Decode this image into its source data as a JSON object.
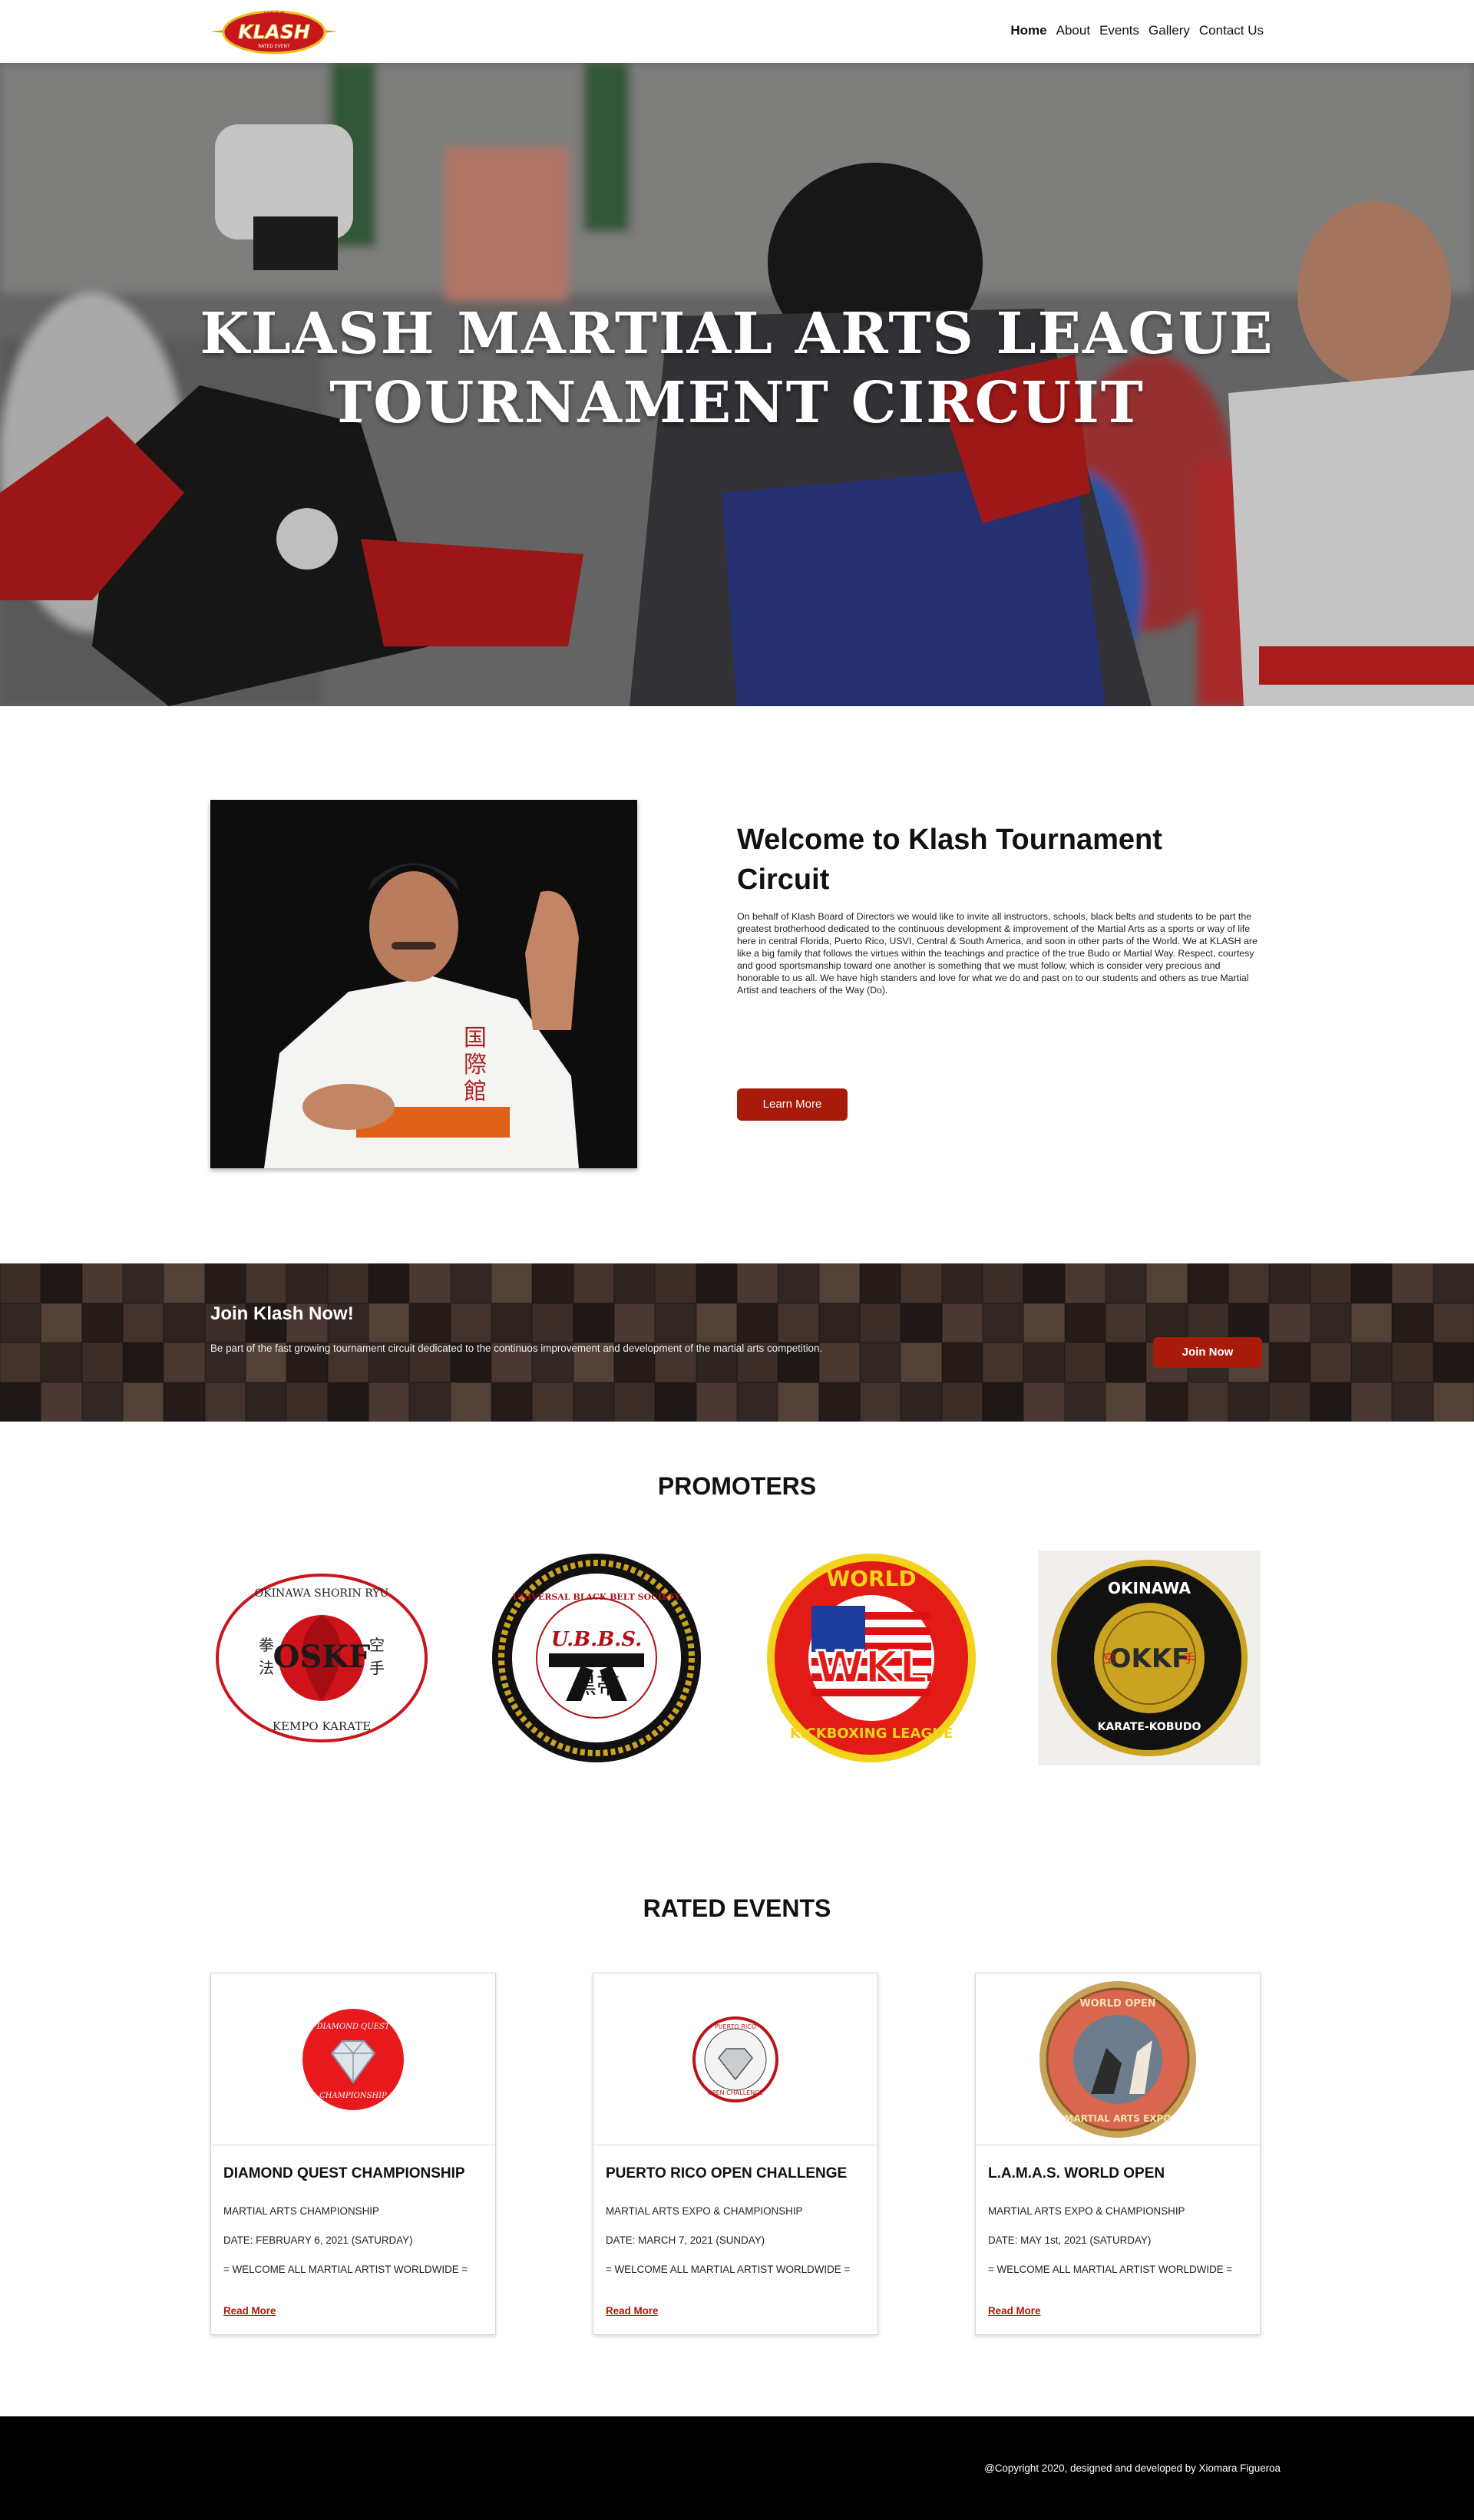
{
  "nav": {
    "logo": {
      "top_text": "UBBS",
      "main_text": "KLASH",
      "bottom_text": "RATED EVENT"
    },
    "items": [
      {
        "label": "Home",
        "active": true
      },
      {
        "label": "About"
      },
      {
        "label": "Events"
      },
      {
        "label": "Gallery"
      },
      {
        "label": "Contact Us"
      }
    ]
  },
  "hero": {
    "title_line1": "KLASH MARTIAL ARTS LEAGUE",
    "title_line2": "TOURNAMENT CIRCUIT"
  },
  "welcome": {
    "title": "Welcome to Klash Tournament Circuit",
    "text": "On behalf of Klash Board of Directors we would like to invite all instructors, schools, black belts and students to be part the greatest brotherhood dedicated to the continuous development & improvement of the Martial Arts as a sports or way of life here in central Florida, Puerto Rico, USVI, Central & South America, and soon in other parts of the World. We at KLASH are like a big family that follows the virtues within the teachings and practice of the true Budo or Martial Way. Respect, courtesy and good sportsmanship toward one another is something that we must follow, which is consider very precious and honorable to us all. We have high standers and love for what we do and past on to our students and others as true Martial Artist and teachers of the Way (Do).",
    "button": "Learn More"
  },
  "join": {
    "title": "Join Klash Now!",
    "text": "Be part of the fast growing tournament circuit dedicated to the continuos improvement and development of the martial arts competition.",
    "button": "Join Now"
  },
  "promoters": {
    "title": "PROMOTERS",
    "logos": [
      {
        "name": "OSKF",
        "arc_top": "OKINAWA SHORIN RYU",
        "arc_bottom": "KEMPO KARATE",
        "color": "#d0121b"
      },
      {
        "name": "U.B.B.S.",
        "arc_top": "UNIVERSAL BLACK BELT SOCIETY",
        "kanji": "黒帯",
        "color": "#b01016"
      },
      {
        "name": "WKL",
        "arc_top": "WORLD",
        "arc_bottom": "KICKBOXING LEAGUE",
        "color": "#e21b16"
      },
      {
        "name": "OKKF",
        "arc_top": "OKINAWA",
        "arc_bottom": "KARATE-KOBUDO",
        "color": "#111111"
      }
    ]
  },
  "events": {
    "title": "RATED EVENTS",
    "cards": [
      {
        "title": "DIAMOND QUEST CHAMPIONSHIP",
        "type": "MARTIAL ARTS CHAMPIONSHIP",
        "date": "DATE:  FEBRUARY 6, 2021 (SATURDAY)",
        "welcome": "= WELCOME ALL MARTIAL ARTIST WORLDWIDE =",
        "read_more": "Read More",
        "badge_top": "DIAMOND QUEST",
        "badge_bottom": "CHAMPIONSHIP"
      },
      {
        "title": "PUERTO RICO OPEN CHALLENGE",
        "type": "MARTIAL ARTS EXPO & CHAMPIONSHIP",
        "date": "DATE:  MARCH 7, 2021 (SUNDAY)",
        "welcome": "= WELCOME ALL MARTIAL ARTIST WORLDWIDE =",
        "read_more": "Read More",
        "badge_top": "PUERTO RICO",
        "badge_bottom": "OPEN CHALLENGE"
      },
      {
        "title": "L.A.M.A.S. WORLD OPEN",
        "type": "MARTIAL ARTS EXPO & CHAMPIONSHIP",
        "date": "DATE: MAY 1st, 2021 (SATURDAY)",
        "welcome": "= WELCOME ALL MARTIAL ARTIST WORLDWIDE =",
        "read_more": "Read More",
        "badge_top": "WORLD OPEN",
        "badge_bottom": "MARTIAL ARTS EXPO"
      }
    ]
  },
  "footer": {
    "copyright": "@Copyright 2020, designed and developed by Xiomara Figueroa"
  },
  "colors": {
    "accent": "#a81a0a",
    "footer": "#000000"
  }
}
